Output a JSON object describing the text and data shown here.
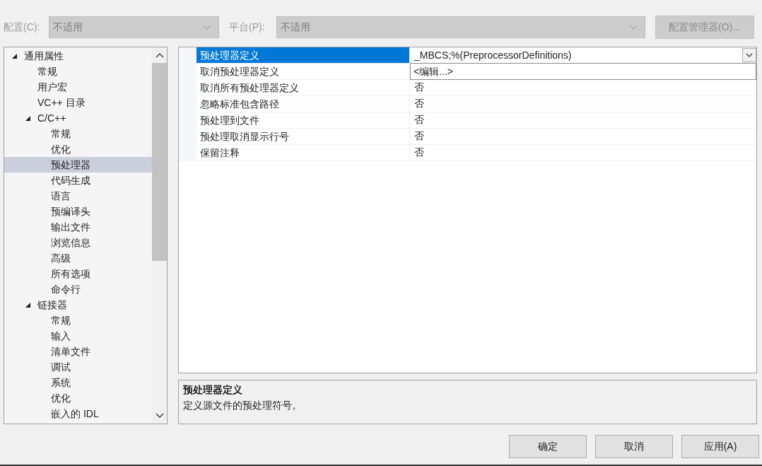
{
  "toolbar": {
    "configuration": {
      "label": "配置(C):",
      "value": "不适用",
      "disabled": true
    },
    "platform": {
      "label": "平台(P):",
      "value": "不适用",
      "disabled": true
    },
    "manager_button": {
      "label": "配置管理器(O)...",
      "disabled": true
    }
  },
  "tree": [
    {
      "label": "通用属性",
      "expanded": true,
      "selected": false,
      "children": [
        {
          "label": "常规",
          "selected": false
        },
        {
          "label": "用户宏",
          "selected": false
        },
        {
          "label": "VC++ 目录",
          "selected": false
        },
        {
          "label": "C/C++",
          "expanded": true,
          "selected": false,
          "children": [
            {
              "label": "常规",
              "selected": false
            },
            {
              "label": "优化",
              "selected": false
            },
            {
              "label": "预处理器",
              "selected": true
            },
            {
              "label": "代码生成",
              "selected": false
            },
            {
              "label": "语言",
              "selected": false
            },
            {
              "label": "预编译头",
              "selected": false
            },
            {
              "label": "输出文件",
              "selected": false
            },
            {
              "label": "浏览信息",
              "selected": false
            },
            {
              "label": "高级",
              "selected": false
            },
            {
              "label": "所有选项",
              "selected": false
            },
            {
              "label": "命令行",
              "selected": false
            }
          ]
        },
        {
          "label": "链接器",
          "expanded": true,
          "selected": false,
          "children": [
            {
              "label": "常规",
              "selected": false
            },
            {
              "label": "输入",
              "selected": false
            },
            {
              "label": "清单文件",
              "selected": false
            },
            {
              "label": "调试",
              "selected": false
            },
            {
              "label": "系统",
              "selected": false
            },
            {
              "label": "优化",
              "selected": false
            },
            {
              "label": "嵌入的 IDL",
              "selected": false
            }
          ]
        }
      ]
    }
  ],
  "properties": [
    {
      "name": "预处理器定义",
      "value": "_MBCS;%(PreprocessorDefinitions)",
      "selected": true,
      "dropdown": {
        "open": true,
        "options": [
          "<编辑...>"
        ]
      }
    },
    {
      "name": "取消预处理器定义",
      "selected": false
    },
    {
      "name": "取消所有预处理器定义",
      "value": "否",
      "selected": false
    },
    {
      "name": "忽略标准包含路径",
      "value": "否",
      "selected": false
    },
    {
      "name": "预处理到文件",
      "value": "否",
      "selected": false
    },
    {
      "name": "预处理取消显示行号",
      "value": "否",
      "selected": false
    },
    {
      "name": "保留注释",
      "value": "否",
      "selected": false
    }
  ],
  "description": {
    "title": "预处理器定义",
    "text": "定义源文件的预处理符号。"
  },
  "buttons": [
    "确定",
    "取消",
    "应用(A)"
  ]
}
